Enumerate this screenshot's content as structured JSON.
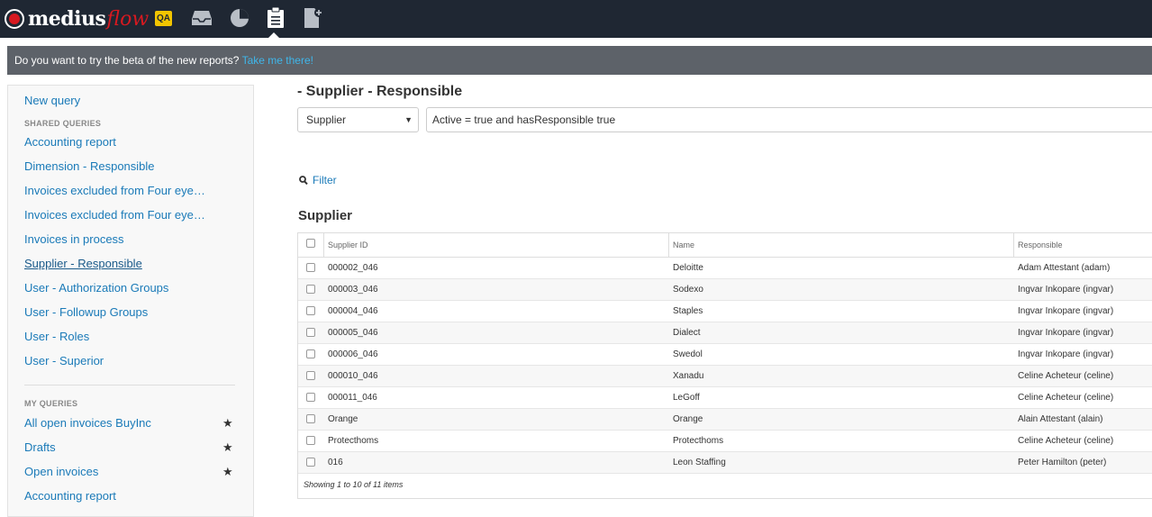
{
  "app": {
    "logo_brand": "medius",
    "logo_product": "flow",
    "env_badge": "QA",
    "nav_icons": [
      "inbox-icon",
      "analytics-icon",
      "reports-icon",
      "new-document-icon"
    ]
  },
  "banner": {
    "text": "Do you want to try the beta of the new reports?",
    "link": "Take me there!"
  },
  "sidebar": {
    "new_query": "New query",
    "shared_heading": "SHARED QUERIES",
    "shared": [
      "Accounting report",
      "Dimension - Responsible",
      "Invoices excluded from Four eye…",
      "Invoices excluded from Four eye…",
      "Invoices in process",
      "Supplier - Responsible",
      "User - Authorization Groups",
      "User - Followup Groups",
      "User - Roles",
      "User - Superior"
    ],
    "active_item": "Supplier - Responsible",
    "my_heading": "MY QUERIES",
    "mine": [
      {
        "label": "All open invoices BuyInc",
        "starred": true
      },
      {
        "label": "Drafts",
        "starred": true
      },
      {
        "label": "Open invoices",
        "starred": true
      },
      {
        "label": "Accounting report",
        "starred": false
      }
    ]
  },
  "main": {
    "title": "- Supplier - Responsible",
    "entity_select": "Supplier",
    "query": "Active = true and hasResponsible true",
    "filter_label": "Filter",
    "section_title": "Supplier"
  },
  "table": {
    "columns": [
      "Supplier ID",
      "Name",
      "Responsible"
    ],
    "rows": [
      [
        "000002_046",
        "Deloitte",
        "Adam Attestant (adam)"
      ],
      [
        "000003_046",
        "Sodexo",
        "Ingvar Inkopare (ingvar)"
      ],
      [
        "000004_046",
        "Staples",
        "Ingvar Inkopare (ingvar)"
      ],
      [
        "000005_046",
        "Dialect",
        "Ingvar Inkopare (ingvar)"
      ],
      [
        "000006_046",
        "Swedol",
        "Ingvar Inkopare (ingvar)"
      ],
      [
        "000010_046",
        "Xanadu",
        "Celine Acheteur (celine)"
      ],
      [
        "000011_046",
        "LeGoff",
        "Celine Acheteur (celine)"
      ],
      [
        "Orange",
        "Orange",
        "Alain Attestant (alain)"
      ],
      [
        "Protecthoms",
        "Protecthoms",
        "Celine Acheteur (celine)"
      ],
      [
        "016",
        "Leon Staffing",
        "Peter Hamilton (peter)"
      ]
    ],
    "footer": "Showing 1 to 10 of 11 items"
  },
  "colors": {
    "topbar": "#1f2733",
    "brand_red": "#d71920",
    "link": "#1a7ab8",
    "banner": "#5d6269",
    "banner_link": "#3fb6ea",
    "qa_badge": "#f2c500"
  }
}
